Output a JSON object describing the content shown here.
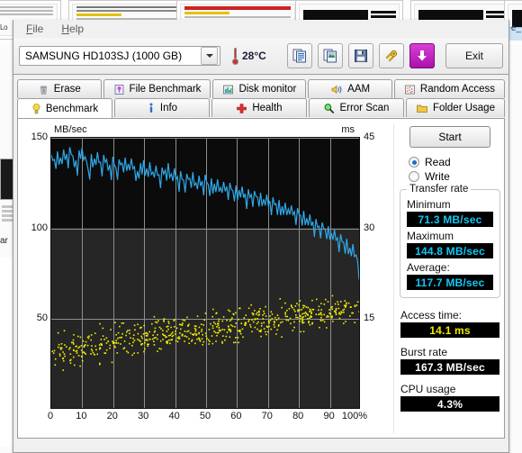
{
  "background": {
    "left_fragment": "Lo",
    "right_fragment": "e_",
    "left_word": "ar"
  },
  "window": {
    "menu": [
      {
        "label": "File",
        "mnemonic": "F"
      },
      {
        "label": "Help",
        "mnemonic": "H"
      }
    ]
  },
  "toolbar": {
    "drive_selected": "SAMSUNG HD103SJ (1000 GB)",
    "temperature": "28°C",
    "thermometer_icon": "thermometer-icon",
    "buttons": [
      {
        "name": "copy-icon",
        "label": "Copy"
      },
      {
        "name": "copy-image-icon",
        "label": "Copy image"
      },
      {
        "name": "save-icon",
        "label": "Save"
      },
      {
        "name": "link-icon",
        "label": "Link"
      },
      {
        "name": "download-icon",
        "label": "Download"
      }
    ],
    "exit_label": "Exit"
  },
  "tabs": {
    "row1": [
      {
        "label": "Erase",
        "icon": "trash-icon",
        "active": false
      },
      {
        "label": "File Benchmark",
        "icon": "file-benchmark-icon",
        "active": false
      },
      {
        "label": "Disk monitor",
        "icon": "bar-chart-icon",
        "active": false
      },
      {
        "label": "AAM",
        "icon": "speaker-icon",
        "active": false
      },
      {
        "label": "Random Access",
        "icon": "random-access-icon",
        "active": false
      }
    ],
    "row2": [
      {
        "label": "Benchmark",
        "icon": "bulb-icon",
        "active": true
      },
      {
        "label": "Info",
        "icon": "info-icon",
        "active": false
      },
      {
        "label": "Health",
        "icon": "cross-icon",
        "active": false
      },
      {
        "label": "Error Scan",
        "icon": "magnifier-icon",
        "active": false
      },
      {
        "label": "Folder Usage",
        "icon": "folder-icon",
        "active": false
      }
    ]
  },
  "controls": {
    "start_label": "Start",
    "mode_read": "Read",
    "mode_write": "Write",
    "mode_selected": "Read"
  },
  "transfer_rate": {
    "group_title": "Transfer rate",
    "minimum_label": "Minimum",
    "minimum_value": "71.3 MB/sec",
    "maximum_label": "Maximum",
    "maximum_value": "144.8 MB/sec",
    "average_label": "Average:",
    "average_value": "117.7 MB/sec"
  },
  "stats": {
    "access_time_label": "Access time:",
    "access_time_value": "14.1 ms",
    "burst_rate_label": "Burst rate",
    "burst_rate_value": "167.3 MB/sec",
    "cpu_usage_label": "CPU usage",
    "cpu_usage_value": "4.3%"
  },
  "colors": {
    "transfer_line": "#2fa8e8",
    "access_dots": "#f5f000",
    "plot_bg": "#262626",
    "plot_bg_top": "#0b0b0b",
    "grid": "#8d8d8d",
    "lcd_cyan": "#11c8f5",
    "lcd_yellow": "#f3ea00"
  },
  "chart_data": {
    "type": "line",
    "title": "",
    "xlabel": "",
    "ylabel": "MB/sec",
    "y2label": "ms",
    "xlim": [
      0,
      100
    ],
    "ylim": [
      0,
      150
    ],
    "y2lim": [
      0,
      45
    ],
    "grid": true,
    "legend": "none",
    "xticks": [
      0,
      10,
      20,
      30,
      40,
      50,
      60,
      70,
      80,
      90,
      100
    ],
    "xticklabels": [
      "0",
      "10",
      "20",
      "30",
      "40",
      "50",
      "60",
      "70",
      "80",
      "90",
      "100%"
    ],
    "yticks": [
      50,
      100,
      150
    ],
    "yticklabels": [
      "50",
      "100",
      "150"
    ],
    "y2ticks": [
      15,
      30,
      45
    ],
    "y2ticklabels": [
      "15",
      "30",
      "45"
    ],
    "series": [
      {
        "name": "Transfer rate",
        "axis": "left",
        "unit": "MB/sec",
        "color": "#2fa8e8",
        "x": [
          0,
          1,
          2,
          3,
          4,
          5,
          6,
          7,
          8,
          9,
          10,
          11,
          12,
          13,
          14,
          15,
          16,
          17,
          18,
          19,
          20,
          21,
          22,
          23,
          24,
          25,
          26,
          27,
          28,
          29,
          30,
          31,
          32,
          33,
          34,
          35,
          36,
          37,
          38,
          39,
          40,
          41,
          42,
          43,
          44,
          45,
          46,
          47,
          48,
          49,
          50,
          51,
          52,
          53,
          54,
          55,
          56,
          57,
          58,
          59,
          60,
          61,
          62,
          63,
          64,
          65,
          66,
          67,
          68,
          69,
          70,
          71,
          72,
          73,
          74,
          75,
          76,
          77,
          78,
          79,
          80,
          81,
          82,
          83,
          84,
          85,
          86,
          87,
          88,
          89,
          90,
          91,
          92,
          93,
          94,
          95,
          96,
          97,
          98,
          99,
          100
        ],
        "y": [
          140.5,
          138.0,
          142.5,
          139.0,
          143.5,
          141.0,
          144.8,
          140.0,
          137.5,
          143.0,
          144.5,
          139.5,
          132.0,
          141.0,
          138.5,
          142.0,
          136.5,
          140.5,
          138.0,
          135.0,
          139.5,
          133.5,
          138.0,
          136.0,
          139.0,
          135.5,
          138.5,
          134.0,
          131.5,
          136.0,
          137.5,
          133.0,
          136.5,
          131.0,
          134.5,
          129.5,
          133.5,
          132.0,
          136.0,
          130.0,
          133.0,
          128.5,
          131.5,
          126.5,
          130.0,
          127.5,
          131.0,
          125.0,
          129.0,
          126.0,
          129.5,
          124.0,
          127.5,
          124.5,
          127.0,
          122.5,
          125.5,
          123.0,
          125.0,
          120.5,
          123.5,
          121.0,
          123.0,
          119.0,
          121.5,
          118.5,
          120.5,
          117.0,
          119.5,
          116.0,
          118.5,
          115.0,
          117.0,
          113.5,
          115.5,
          112.0,
          114.0,
          110.5,
          112.5,
          109.0,
          111.0,
          107.0,
          109.5,
          105.5,
          107.5,
          103.5,
          105.0,
          101.0,
          103.0,
          99.0,
          101.0,
          97.0,
          99.0,
          94.5,
          96.5,
          92.0,
          94.0,
          89.0,
          91.0,
          85.0,
          71.3
        ]
      },
      {
        "name": "Access time",
        "axis": "right",
        "unit": "ms",
        "color": "#f5f000",
        "type": "scatter",
        "mean_trend_start_ms": 9.5,
        "mean_trend_end_ms": 17.0,
        "spread_ms": 4.5,
        "point_count": 620,
        "average_ms": 14.1
      }
    ]
  }
}
